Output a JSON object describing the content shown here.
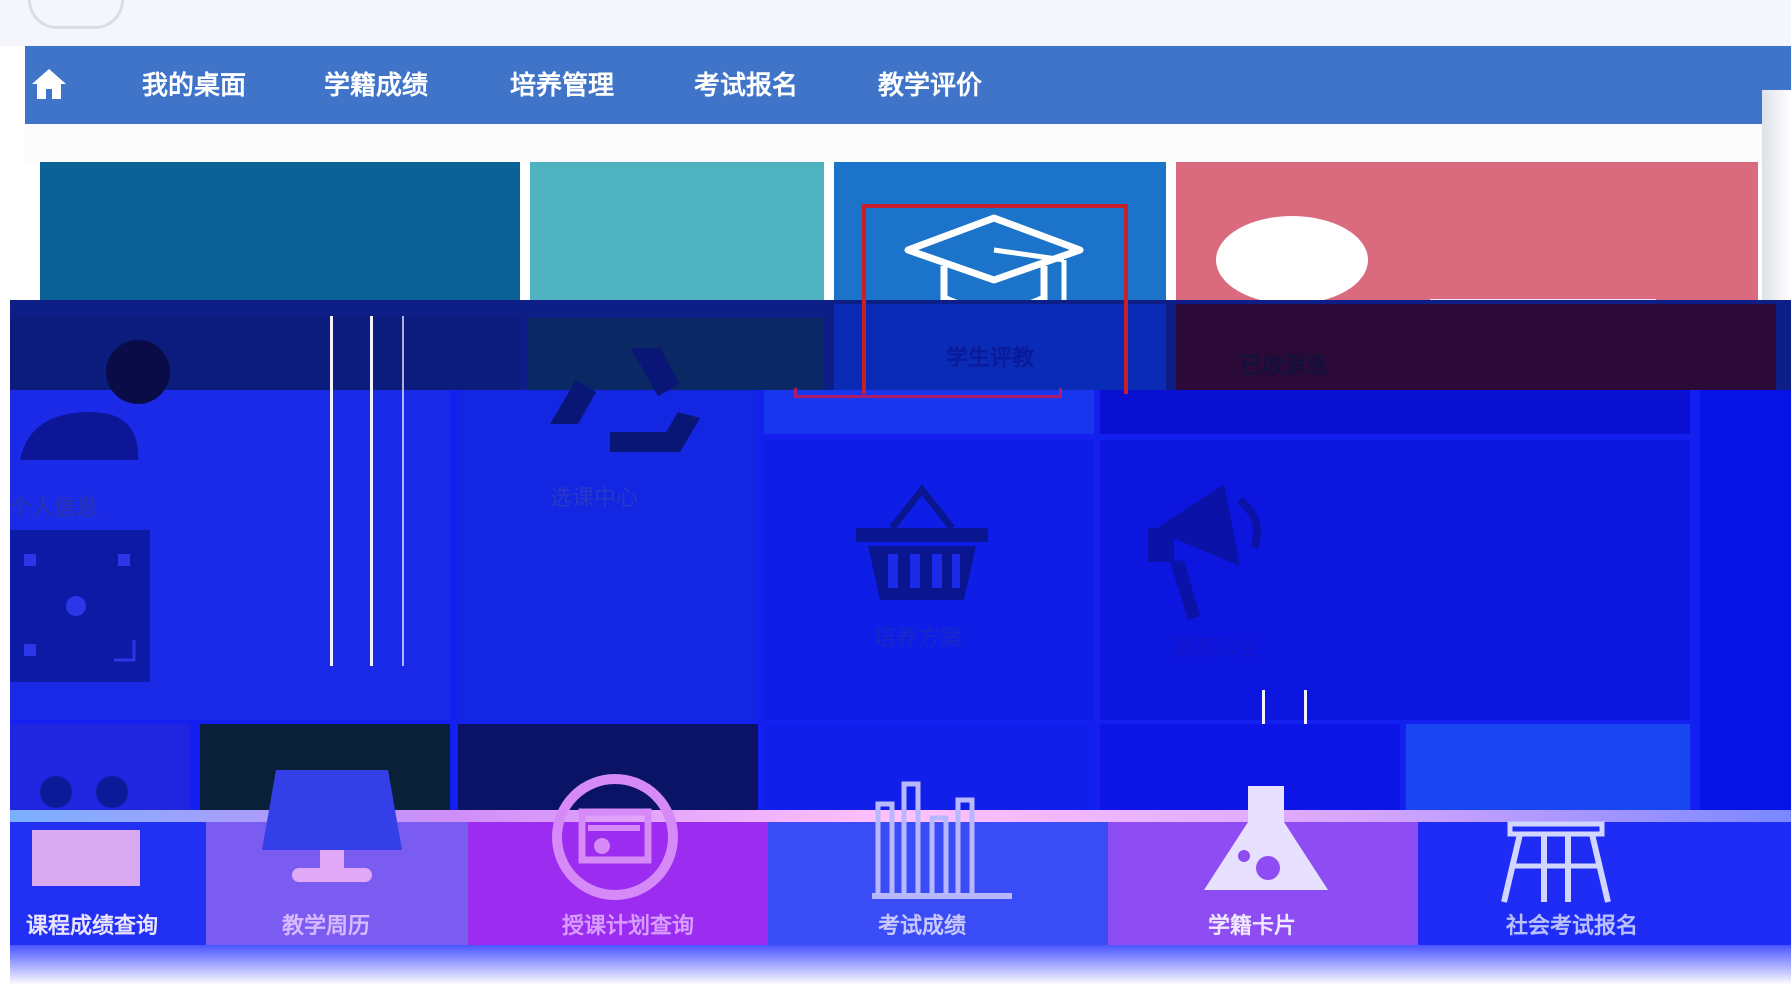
{
  "nav": {
    "items": [
      "我的桌面",
      "学籍成绩",
      "培养管理",
      "考试报名",
      "教学评价"
    ]
  },
  "tiles_top": {
    "student_eval_label": "学生评教",
    "received_messages_label": "已收消息"
  },
  "tiles_mid": {
    "personal_info_label": "个人信息",
    "course_select_label": "选课中心",
    "training_plan_label": "培养方案",
    "notice_label": "通知公告"
  },
  "tiles_bottom": {
    "labels": [
      "课程成绩查询",
      "教学周历",
      "授课计划查询",
      "考试成绩",
      "学籍卡片",
      "社会考试报名"
    ]
  },
  "colors": {
    "navbar": "#3f74c8",
    "tile_dark_teal": "#0b6296",
    "tile_teal": "#4fb3bf",
    "tile_blue": "#1b74c9",
    "tile_pink": "#da6a7e",
    "highlight_frame": "#c8202a"
  },
  "icons": {
    "home": "home-icon",
    "student_eval": "graduation-cap-icon",
    "received_messages": "chat-bubble-icon",
    "personal_info": "user-icon",
    "course_select": "recycle-icon",
    "training_plan": "basket-icon",
    "notice": "megaphone-icon",
    "course_grades": "folder-icon",
    "teaching_calendar": "monitor-icon",
    "teaching_plan": "document-circle-icon",
    "exam_scores": "bar-chart-icon",
    "status_card": "flask-icon",
    "social_exam": "stool-icon"
  }
}
